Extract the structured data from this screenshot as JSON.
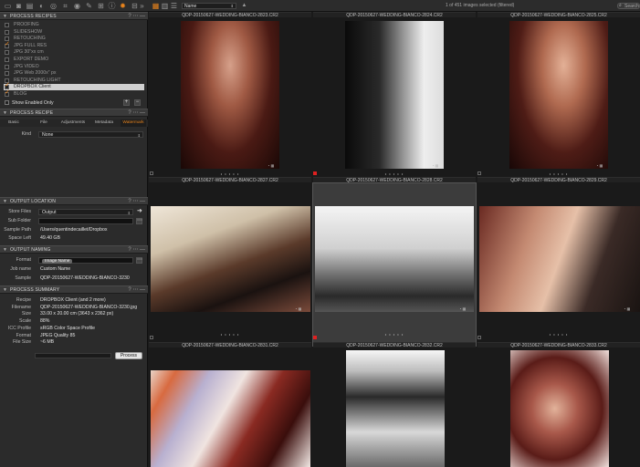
{
  "toolbar": {
    "sort_value": "Name",
    "status_text": "1 of 451 images selected (filtered)",
    "search_placeholder": "Search",
    "accent": "#e8831c"
  },
  "process_recipes": {
    "title": "PROCESS RECIPES",
    "items": [
      {
        "label": "PROOFING",
        "checked": false
      },
      {
        "label": "SLIDESHOW",
        "checked": false
      },
      {
        "label": "RETOUCHING",
        "checked": false
      },
      {
        "label": "JPG FULL RES",
        "checked": true
      },
      {
        "label": "JPG 30\"xx cm",
        "checked": false
      },
      {
        "label": "EXPORT DEMO",
        "checked": false
      },
      {
        "label": "JPG VIDEO",
        "checked": false
      },
      {
        "label": "JPG Web 2000x\" px",
        "checked": false
      },
      {
        "label": "RETOUCHING LIGHT",
        "checked": false
      },
      {
        "label": "DROPBOX Client",
        "checked": true
      },
      {
        "label": "BLOG",
        "checked": true
      }
    ],
    "show_enabled_label": "Show Enabled Only"
  },
  "process_recipe": {
    "title": "PROCESS RECIPE",
    "tabs": [
      "Basic",
      "File",
      "Adjustments",
      "Metadata",
      "Watermark"
    ],
    "kind_label": "Kind",
    "kind_value": "None"
  },
  "output_location": {
    "title": "OUTPUT LOCATION",
    "store_files_label": "Store Files",
    "store_files_value": "Output",
    "sub_folder_label": "Sub Folder",
    "sample_path_label": "Sample Path",
    "sample_path_value": "/Users/quentindecaillet/Dropbox",
    "space_left_label": "Space Left",
    "space_left_value": "49.40 GB"
  },
  "output_naming": {
    "title": "OUTPUT NAMING",
    "format_label": "Format",
    "format_token": "Image Name",
    "job_name_label": "Job name",
    "job_name_value": "Custom Name",
    "sample_label": "Sample",
    "sample_value": "QDP-20150627-WEDDING-BIANCO-3230"
  },
  "process_summary": {
    "title": "PROCESS SUMMARY",
    "rows": [
      {
        "label": "Recipe",
        "value": "DROPBOX Client (and 2 more)"
      },
      {
        "label": "Filename",
        "value": "QDP-20150627-WEDDING-BIANCO-3230.jpg"
      },
      {
        "label": "Size",
        "value": "33.00 x 20.00 cm (3643 x 2362 px)"
      },
      {
        "label": "Scale",
        "value": "88%"
      },
      {
        "label": "ICC Profile",
        "value": "sRGB Color Space Profile"
      },
      {
        "label": "Format",
        "value": "JPEG Quality 85"
      },
      {
        "label": "File Size",
        "value": "~6 MB"
      }
    ],
    "process_button": "Process"
  },
  "grid": {
    "top_captions": [
      "QDP-20150627-WEDDING-BIANCO-2823.CR2",
      "QDP-20150627-WEDDING-BIANCO-2824.CR2",
      "QDP-20150627-WEDDING-BIANCO-2825.CR2"
    ],
    "row1_captions": [
      "QDP-20150627-WEDDING-BIANCO-2827.CR2",
      "QDP-20150627-WEDDING-BIANCO-2828.CR2",
      "QDP-20150627-WEDDING-BIANCO-2829.CR2"
    ],
    "row2_captions": [
      "QDP-20150627-WEDDING-BIANCO-2831.CR2",
      "QDP-20150627-WEDDING-BIANCO-2832.CR2",
      "QDP-20150627-WEDDING-BIANCO-2833.CR2"
    ],
    "dots": "• • • • •",
    "tag_color": "#e02020"
  }
}
